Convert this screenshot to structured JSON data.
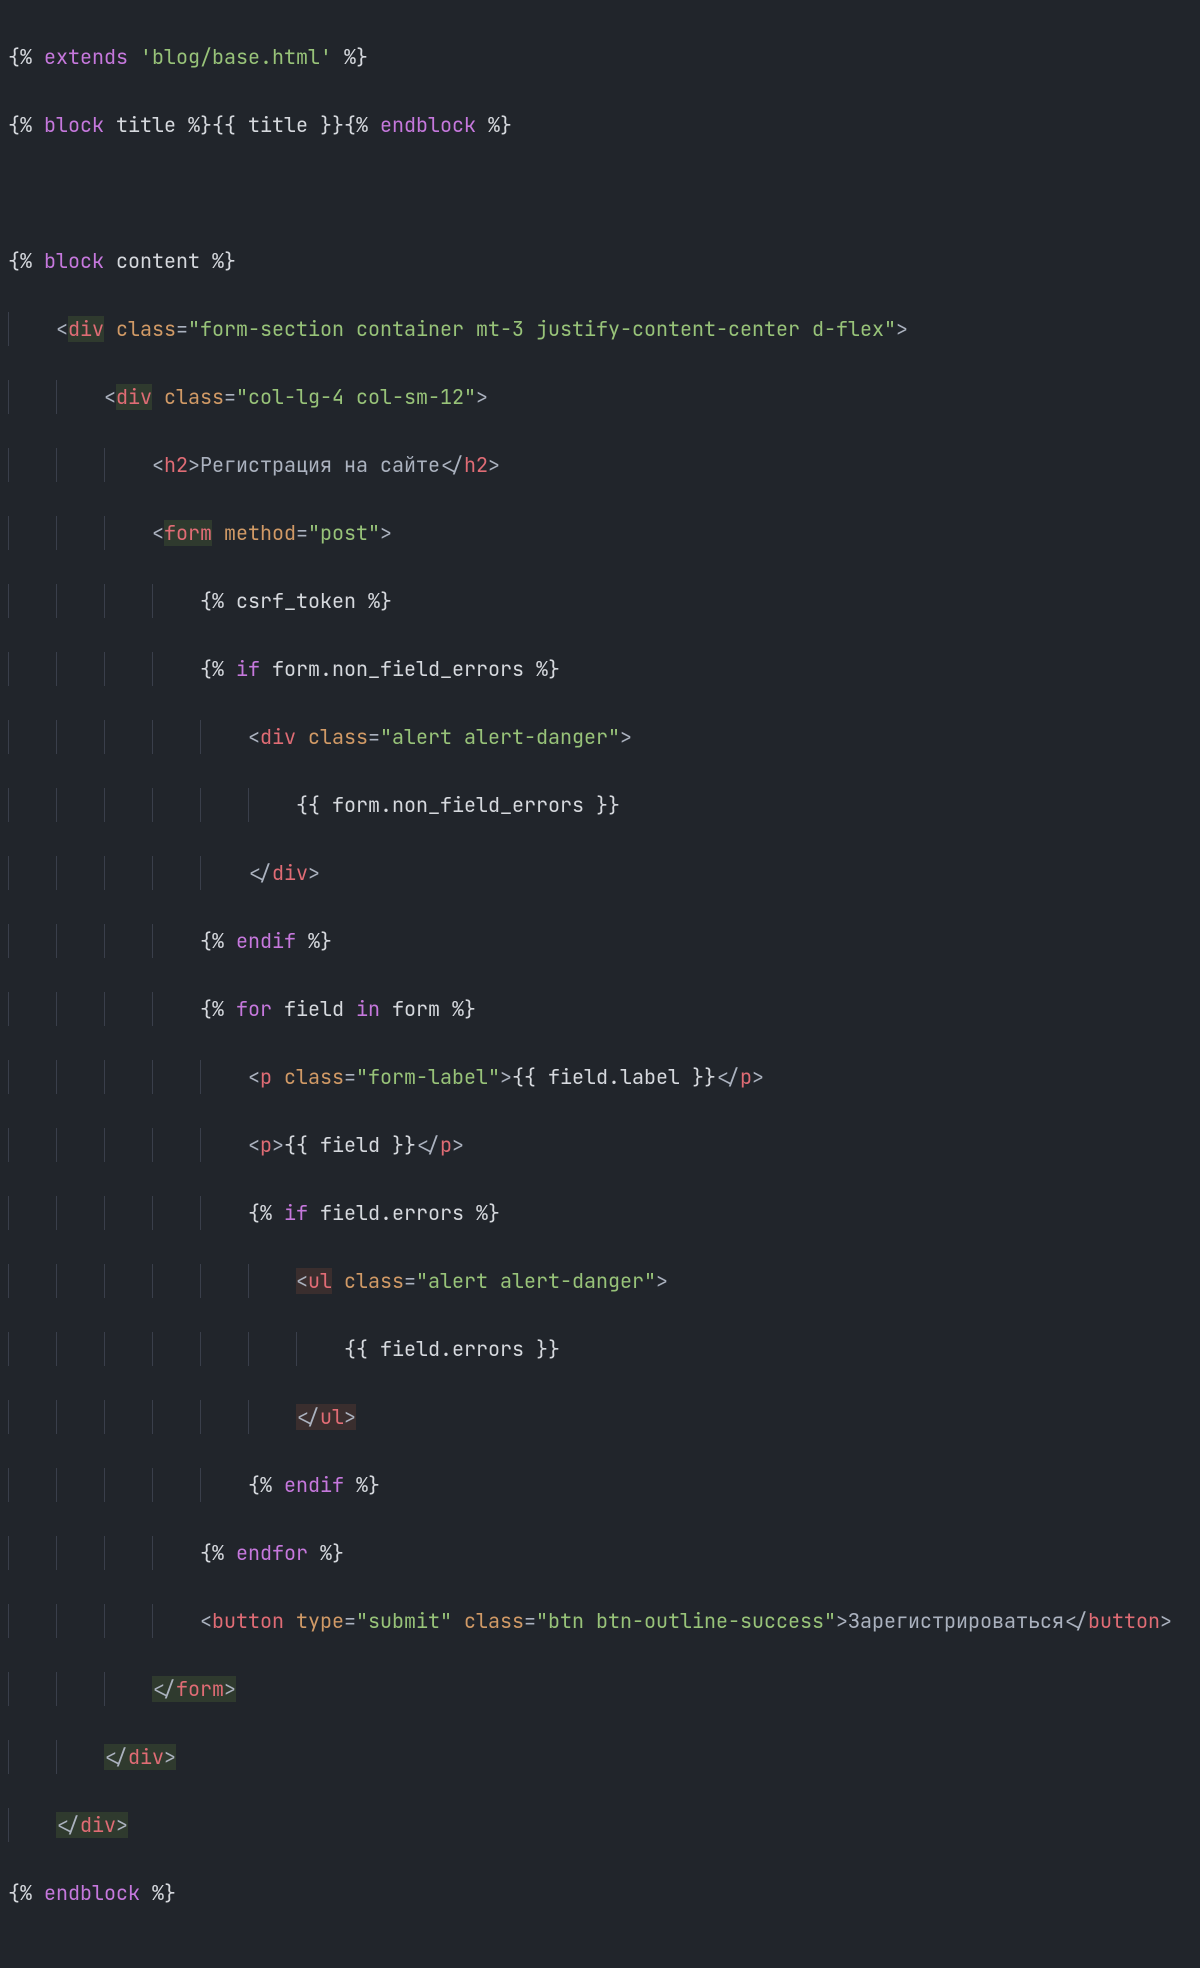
{
  "code": {
    "l1": {
      "extends": "extends",
      "path": "'blog/base.html'"
    },
    "l2": {
      "block": "block",
      "name": "title",
      "var": "title",
      "endblock": "endblock"
    },
    "l4": {
      "block": "block",
      "name": "content"
    },
    "l5": {
      "tag": "div",
      "attr": "class",
      "val": "\"form-section container mt-3 justify-content-center d-flex\""
    },
    "l6": {
      "tag": "div",
      "attr": "class",
      "val": "\"col-lg-4 col-sm-12\""
    },
    "l7": {
      "tag_open": "h2",
      "text": "Регистрация на сайте",
      "tag_close": "h2"
    },
    "l8": {
      "tag": "form",
      "attr": "method",
      "val": "\"post\""
    },
    "l9": {
      "token": "csrf_token"
    },
    "l10": {
      "kw": "if",
      "expr_obj": "form",
      "expr_prop": ".non_field_errors"
    },
    "l11": {
      "tag": "div",
      "attr": "class",
      "val": "\"alert alert-danger\""
    },
    "l12": {
      "expr_obj": "form",
      "expr_prop": ".non_field_errors"
    },
    "l13": {
      "tag": "div"
    },
    "l14": {
      "kw": "endif"
    },
    "l15": {
      "kw": "for",
      "var": "field",
      "in": "in",
      "src": "form"
    },
    "l16": {
      "tag": "p",
      "attr": "class",
      "val": "\"form-label\"",
      "expr_obj": "field",
      "expr_prop": ".label",
      "tag_close": "p"
    },
    "l17": {
      "tag": "p",
      "expr_obj": "field",
      "tag_close": "p"
    },
    "l18": {
      "kw": "if",
      "expr_obj": "field",
      "expr_prop": ".errors"
    },
    "l19": {
      "tag": "ul",
      "attr": "class",
      "val": "\"alert alert-danger\""
    },
    "l20": {
      "expr_obj": "field",
      "expr_prop": ".errors"
    },
    "l21": {
      "tag": "ul"
    },
    "l22": {
      "kw": "endif"
    },
    "l23": {
      "kw": "endfor"
    },
    "l24": {
      "tag": "button",
      "attr1": "type",
      "val1": "\"submit\"",
      "attr2": "class",
      "val2": "\"btn btn-outline-success\"",
      "text": "Зарегистрироваться",
      "tag_close": "button"
    },
    "l25": {
      "tag": "form"
    },
    "l26": {
      "tag": "div"
    },
    "l27": {
      "tag": "div"
    },
    "l28": {
      "kw": "endblock"
    }
  },
  "delims": {
    "tmpl_open": "{%",
    "tmpl_close": "%}",
    "var_open": "{{",
    "var_close": "}}",
    "lt": "<",
    "gt": ">",
    "lts": "</",
    "eq": "=",
    "sp": " "
  }
}
